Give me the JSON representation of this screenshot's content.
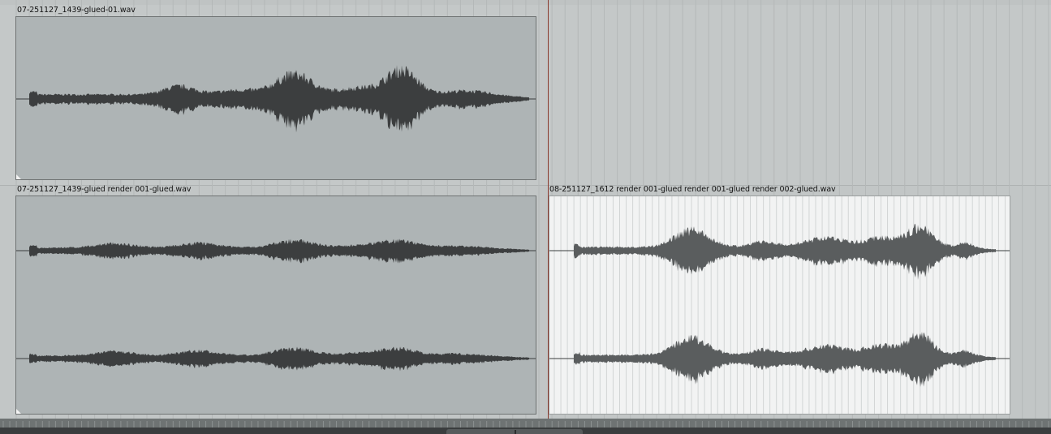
{
  "items": [
    {
      "label": "07-251127_1439-glued-01.wav",
      "channels": 1,
      "selected": false
    },
    {
      "label": "07-251127_1439-glued render 001-glued.wav",
      "channels": 2,
      "selected": false
    },
    {
      "label": "08-251127_1612 render 001-glued render 001-glued render 002-glued.wav",
      "channels": 2,
      "selected": true
    }
  ],
  "colors": {
    "item_bg": "#aeb4b5",
    "item_selected_bg": "#f2f3f3",
    "waveform": "#3c3e3f",
    "waveform_selected": "#5a5d5e",
    "playcursor": "#8a3a2e"
  }
}
